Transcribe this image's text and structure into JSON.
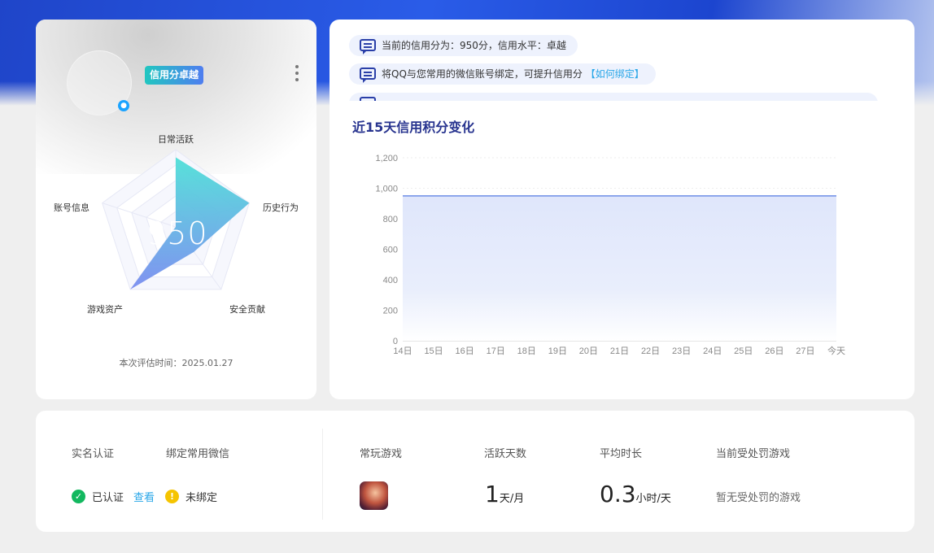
{
  "profile": {
    "level_badge": "信用分卓越",
    "qq_icon": "qq-penguin-icon",
    "score": "950",
    "eval_time": "本次评估时间：2025.01.27",
    "radar": {
      "dimensions": [
        "日常活跃",
        "历史行为",
        "安全贡献",
        "游戏资产",
        "账号信息"
      ],
      "values": [
        0.9,
        1.0,
        0.4,
        1.0,
        0.0
      ],
      "fill_from": "#4fe0d8",
      "fill_to": "#7a8cf0"
    }
  },
  "notices": [
    {
      "text": "当前的信用分为：950分，信用水平：卓越",
      "link": ""
    },
    {
      "text": "将QQ与您常用的微信账号绑定，可提升信用分",
      "link": "【如何绑定】"
    }
  ],
  "chart_title": "近15天信用积分变化",
  "chart_data": {
    "type": "area",
    "title": "近15天信用积分变化",
    "categories": [
      "14日",
      "15日",
      "16日",
      "17日",
      "18日",
      "19日",
      "20日",
      "21日",
      "22日",
      "23日",
      "24日",
      "25日",
      "26日",
      "27日",
      "今天"
    ],
    "values": [
      950,
      950,
      950,
      950,
      950,
      950,
      950,
      950,
      950,
      950,
      950,
      950,
      950,
      950,
      950
    ],
    "yticks": [
      "0",
      "200",
      "400",
      "600",
      "800",
      "1,000",
      "1,200"
    ],
    "ylim": [
      0,
      1200
    ],
    "grid": true,
    "line_color": "#6d8ee6",
    "fill_color": "#dfe6fb"
  },
  "bottom": {
    "headers": {
      "realname": "实名认证",
      "wechat": "绑定常用微信",
      "game": "常玩游戏",
      "active_days": "活跃天数",
      "avg_duration": "平均时长",
      "punished": "当前受处罚游戏"
    },
    "realname_status": "已认证",
    "view_link": "查看",
    "wechat_status": "未绑定",
    "active_days_value": "1",
    "active_days_unit": "天/月",
    "avg_duration_value": "0.3",
    "avg_duration_unit": "小时/天",
    "punished_value": "暂无受处罚的游戏"
  }
}
